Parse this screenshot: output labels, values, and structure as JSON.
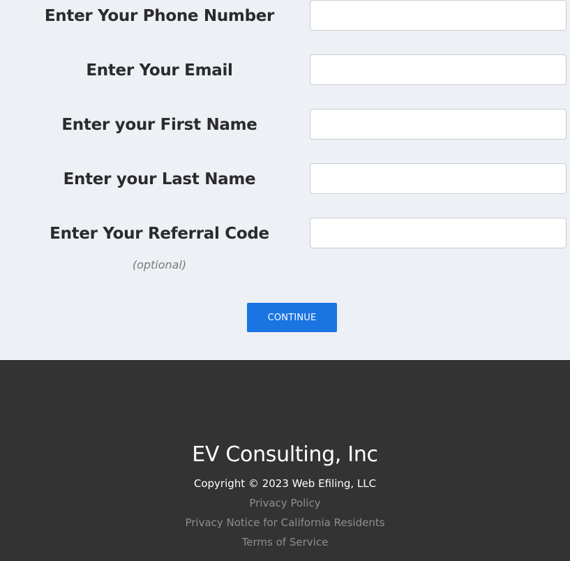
{
  "form": {
    "phone_label": "Enter Your Phone Number",
    "email_label": "Enter Your Email",
    "first_name_label": "Enter your First Name",
    "last_name_label": "Enter your Last Name",
    "referral_label": "Enter Your Referral Code",
    "referral_hint": "(optional)",
    "phone_value": "",
    "email_value": "",
    "first_name_value": "",
    "last_name_value": "",
    "referral_value": "",
    "continue_label": "CONTINUE"
  },
  "footer": {
    "company": "EV Consulting, Inc",
    "copyright": "Copyright © 2023 Web Efiling, LLC",
    "links": [
      "Privacy Policy",
      "Privacy Notice for California Residents",
      "Terms of Service"
    ]
  },
  "colors": {
    "page_background": "#edf0f5",
    "button": "#1a74e2",
    "footer_background": "#333333",
    "footer_link": "#8f8f8f"
  }
}
